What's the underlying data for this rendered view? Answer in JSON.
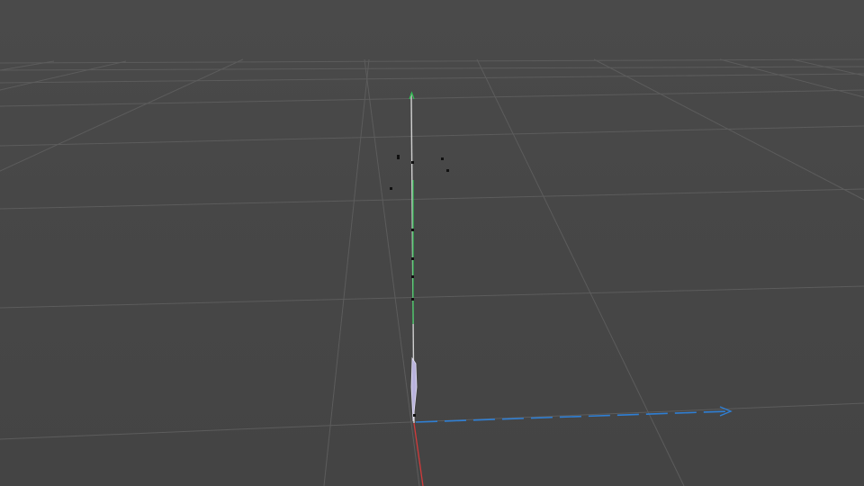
{
  "viewport": {
    "background": "#454545",
    "grid_color": "#5a5a5a",
    "horizon_color": "#626262"
  },
  "axes": {
    "x_axis_color": "#d23a3a",
    "y_axis_color": "#2fbf52",
    "z_axis_color": "#2f7fd4",
    "object_color": "#b9b3dd"
  },
  "icons": {
    "z_axis_arrow": "chevron-right-icon",
    "y_axis_arrow": "chevron-up-icon"
  }
}
